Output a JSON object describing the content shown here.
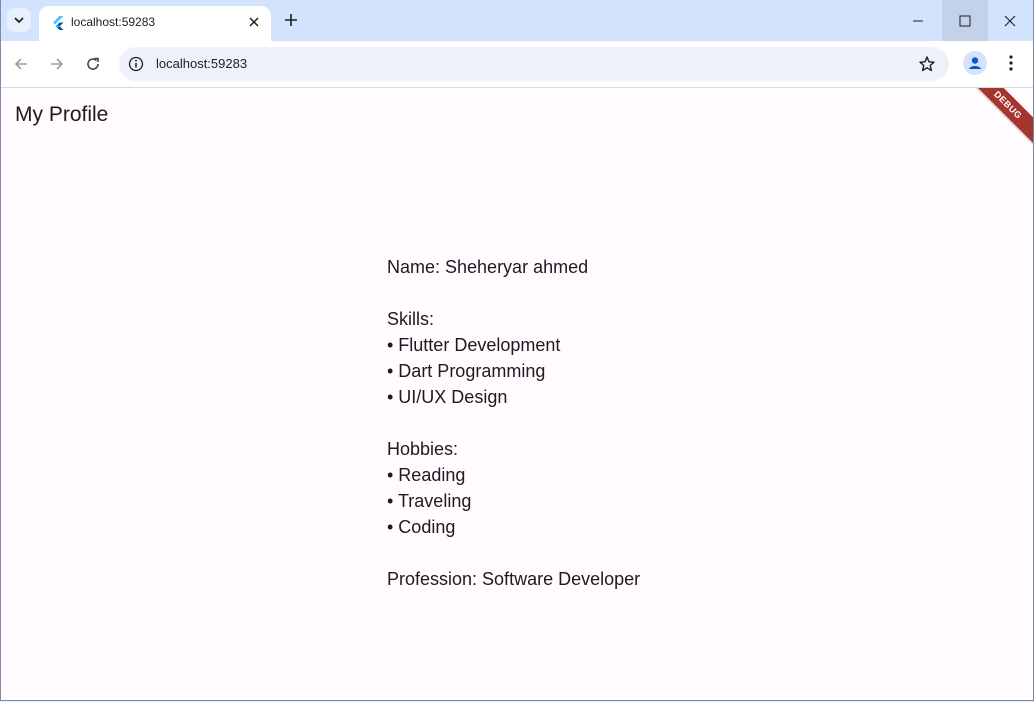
{
  "browser": {
    "tab": {
      "title": "localhost:59283"
    },
    "address_bar": {
      "url": "localhost:59283"
    }
  },
  "app": {
    "title": "My Profile",
    "debug_banner": "DEBUG"
  },
  "profile": {
    "name_line": "Name: Sheheryar ahmed",
    "skills_heading": "Skills:",
    "skills": [
      "• Flutter Development",
      "• Dart Programming",
      "• UI/UX Design"
    ],
    "hobbies_heading": "Hobbies:",
    "hobbies": [
      "• Reading",
      "• Traveling",
      "• Coding"
    ],
    "profession_line": "Profession: Software Developer"
  },
  "colors": {
    "tabstrip": "#d3e3fd",
    "page_background": "#fffbfe",
    "debug_banner": "#a5352e",
    "text": "#1d1b20"
  },
  "icons": [
    "tab-search-icon",
    "flutter-favicon-icon",
    "tab-close-icon",
    "new-tab-icon",
    "minimize-icon",
    "maximize-icon",
    "window-close-icon",
    "back-icon",
    "forward-icon",
    "reload-icon",
    "site-info-icon",
    "bookmark-star-icon",
    "profile-icon",
    "kebab-menu-icon"
  ]
}
